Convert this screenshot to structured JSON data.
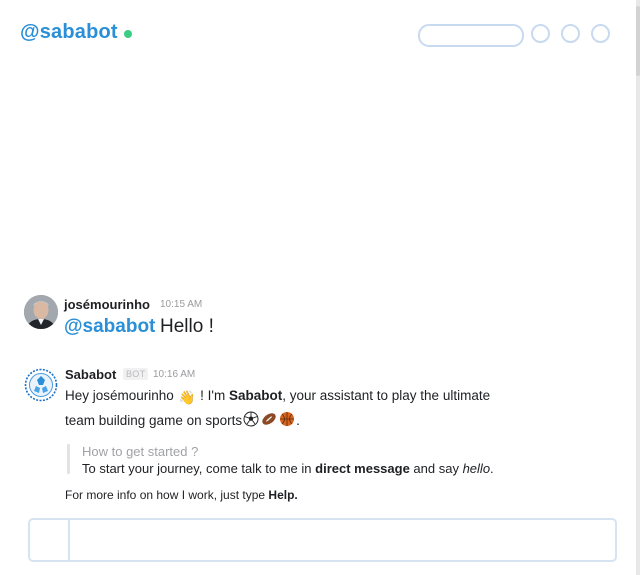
{
  "header": {
    "channel_name": "@sababot",
    "presence_icon": "presence-online-dot",
    "search_placeholder": ""
  },
  "messages": [
    {
      "sender": "josémourinho",
      "time": "10:15 AM",
      "avatar_icon": "user-photo",
      "mention": "@sababot",
      "text": "Hello !"
    },
    {
      "sender": "Sababot",
      "badge": "BOT",
      "time": "10:16 AM",
      "avatar_icon": "sababot-logo-icon",
      "line1": {
        "greeting": "Hey josémourinho",
        "wave_emoji": "👋",
        "im": " ! I'm ",
        "bot_name": "Sababot",
        "rest": ", your assistant to play the ultimate"
      },
      "line2": {
        "text": "team building game on sports",
        "emojis": [
          "soccer-ball-icon",
          "american-football-icon",
          "basketball-icon"
        ],
        "end": "."
      },
      "attachment": {
        "title": "How to get started ?",
        "body_before": "To start your journey, come talk to me in ",
        "body_bold": "direct message",
        "body_mid": " and say ",
        "body_italic": "hello",
        "body_end": "."
      },
      "more_info": {
        "before": "For more info on how I work, just type ",
        "bold": "Help."
      }
    }
  ],
  "composer": {
    "value": "",
    "placeholder": ""
  },
  "colors": {
    "accent_blue": "#2a8fd7",
    "presence_green": "#38cf85",
    "border_light_blue": "#c8daf0"
  }
}
